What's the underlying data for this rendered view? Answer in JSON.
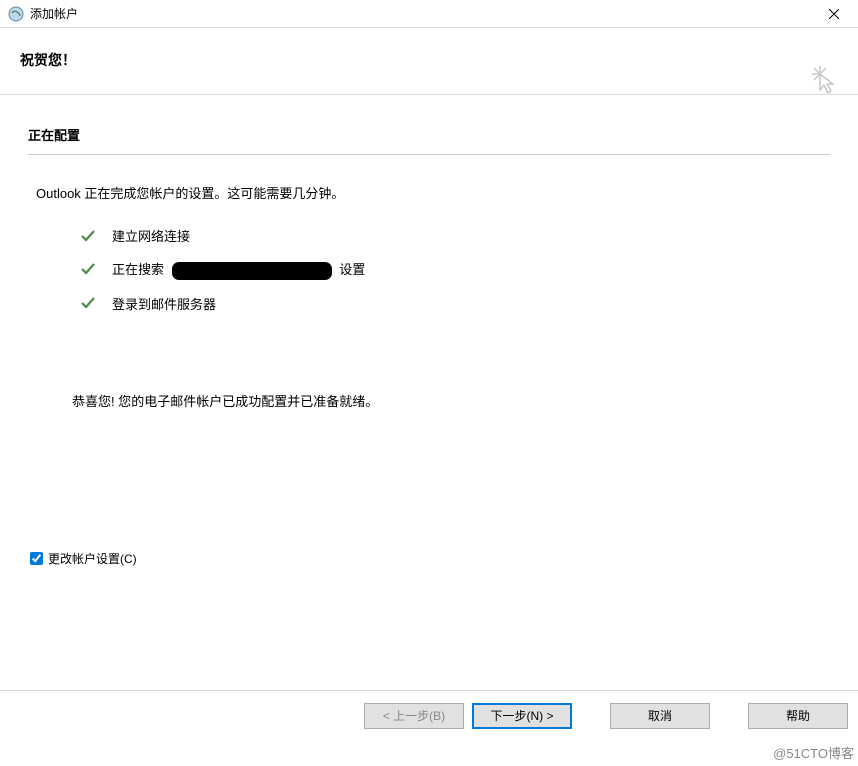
{
  "titlebar": {
    "title": "添加帐户"
  },
  "header": {
    "title": "祝贺您！"
  },
  "section": {
    "title": "正在配置",
    "status": "Outlook 正在完成您帐户的设置。这可能需要几分钟。",
    "steps": [
      {
        "label": "建立网络连接"
      },
      {
        "label_prefix": "正在搜索",
        "label_suffix": "设置"
      },
      {
        "label": "登录到邮件服务器"
      }
    ],
    "success": "恭喜您! 您的电子邮件帐户已成功配置并已准备就绪。"
  },
  "options": {
    "change_settings_label": "更改帐户设置(C)",
    "change_settings_checked": true
  },
  "buttons": {
    "back": "< 上一步(B)",
    "next": "下一步(N) >",
    "cancel": "取消",
    "help": "帮助"
  },
  "watermark": "@51CTO博客",
  "colors": {
    "check": "#4a8b4a",
    "primary": "#0078d7"
  }
}
